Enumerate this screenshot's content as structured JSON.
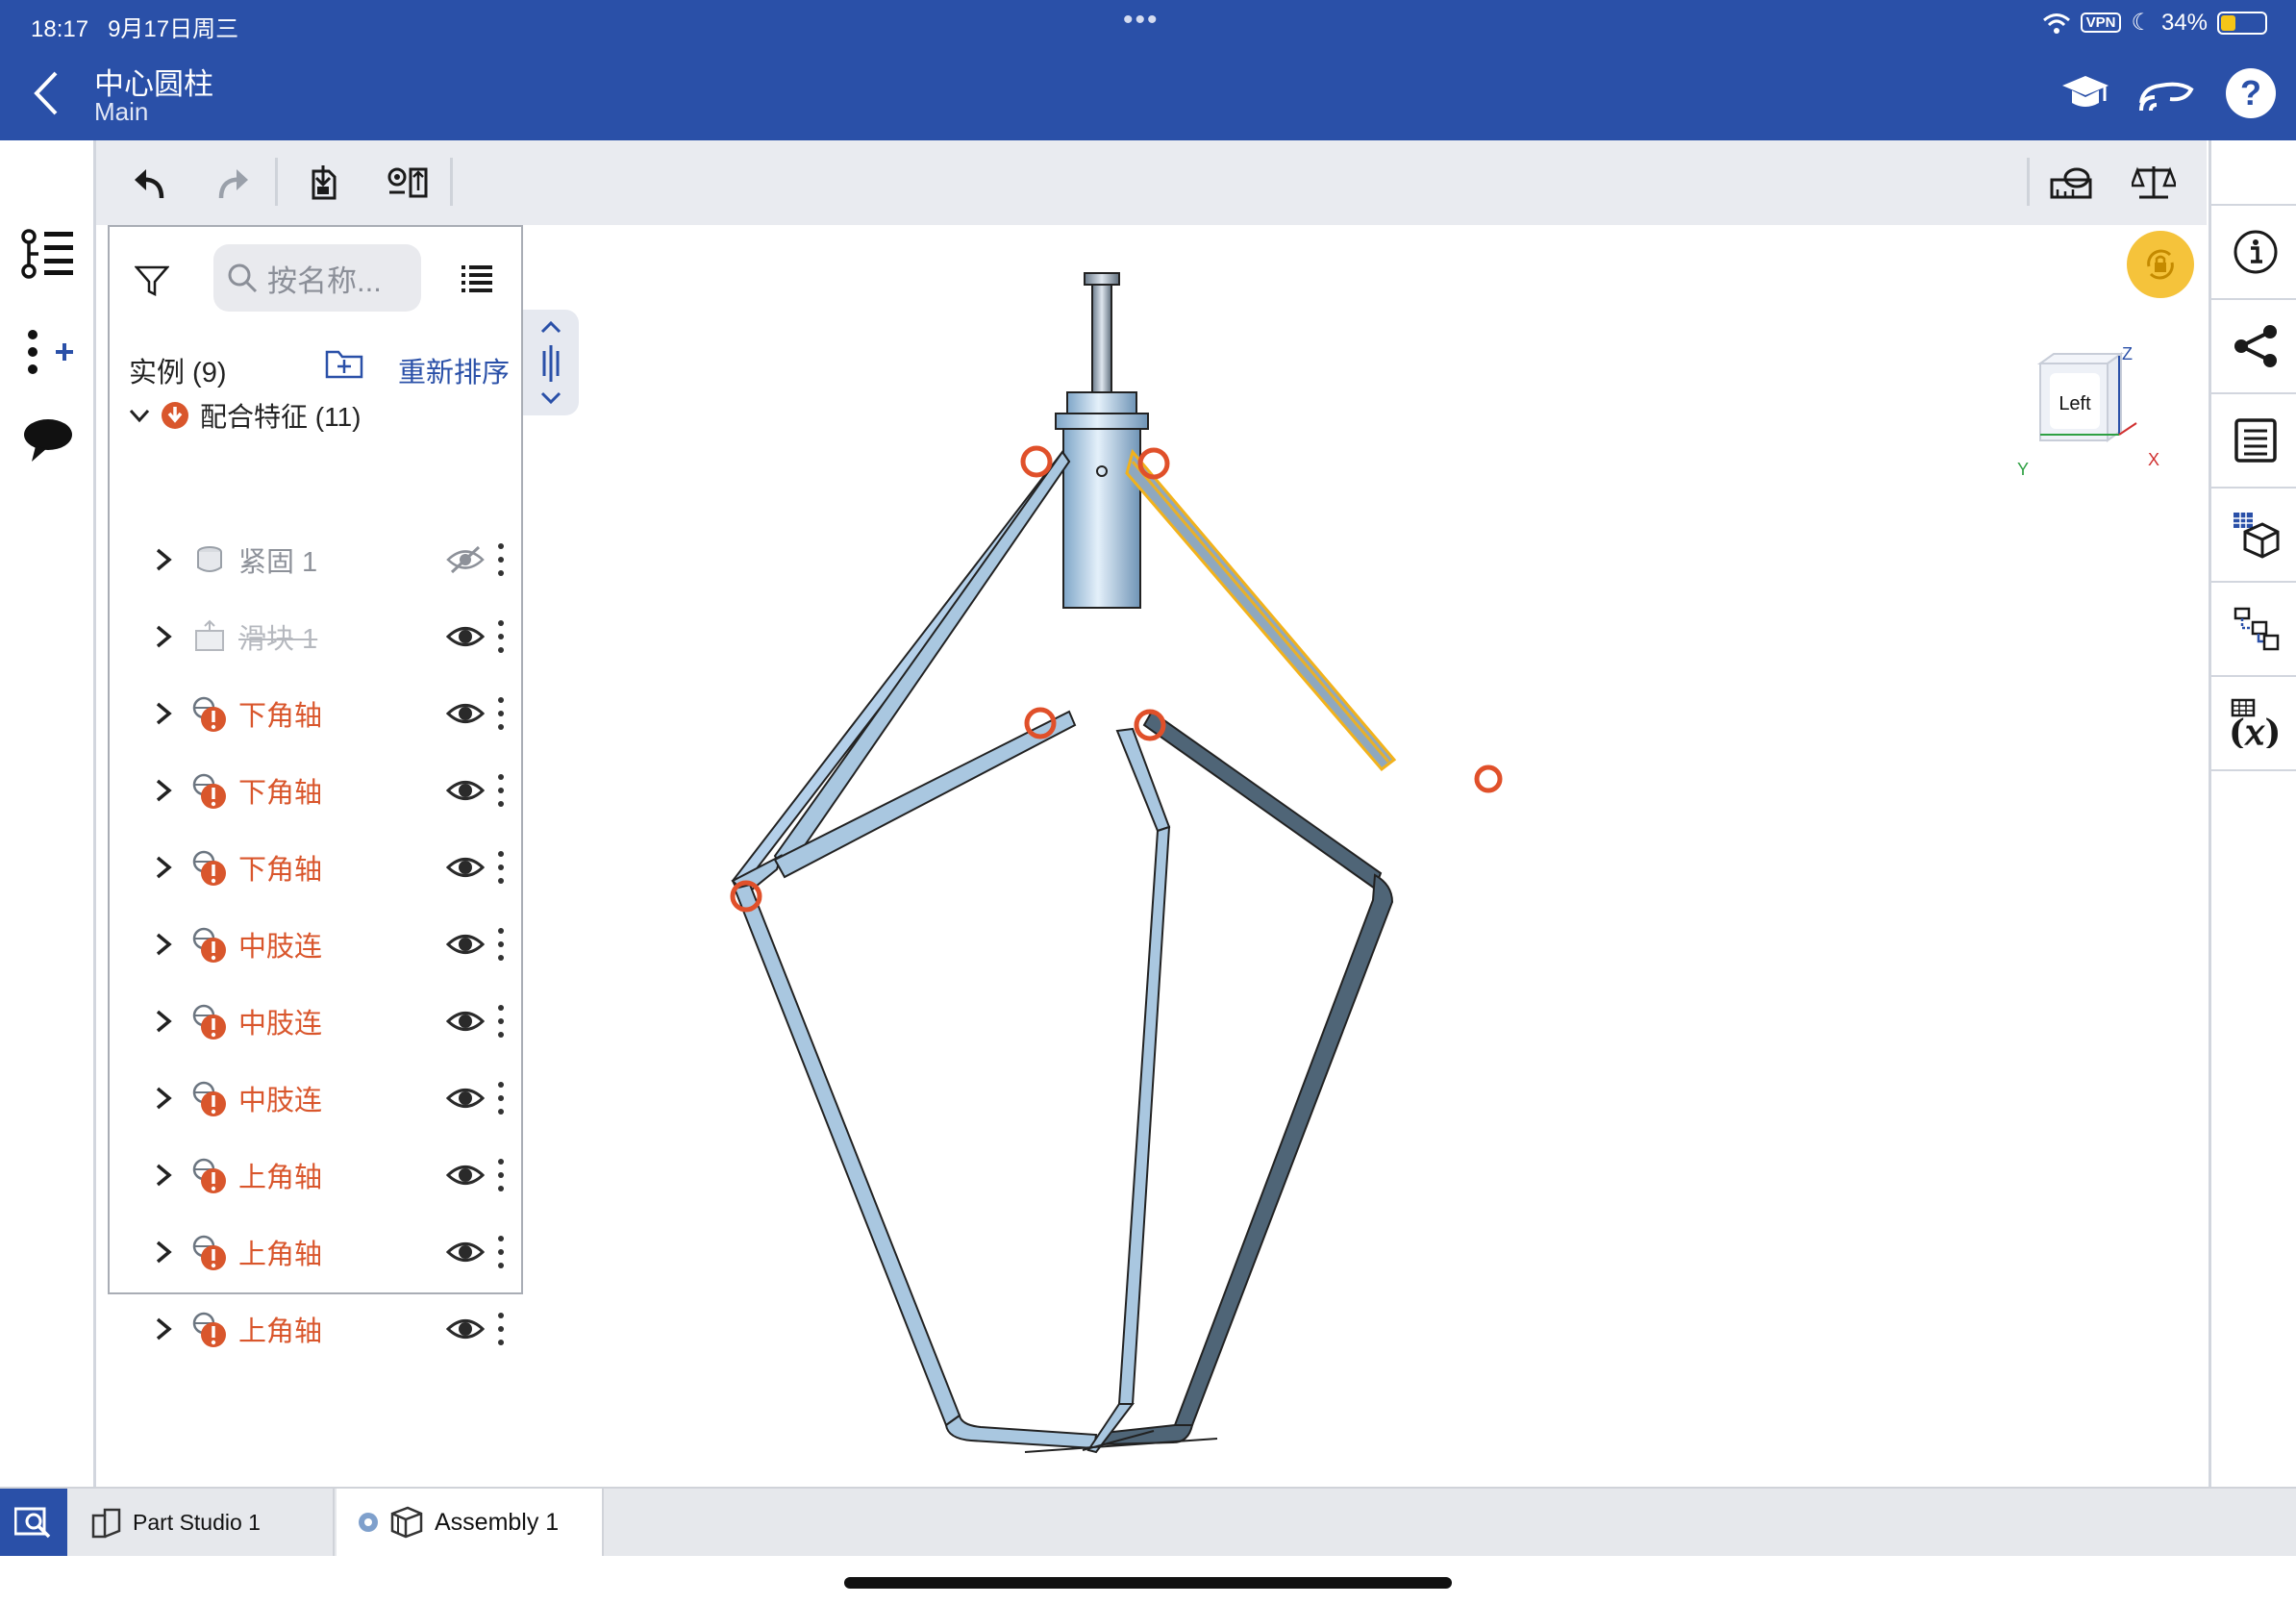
{
  "status": {
    "time": "18:17",
    "date": "9月17日周三",
    "vpn": "VPN",
    "battery": "34%",
    "battery_level": 0.34
  },
  "header": {
    "title": "中心圆柱",
    "subtitle": "Main",
    "icons": [
      "learning-center-icon",
      "connect-icon",
      "help-icon"
    ]
  },
  "left_rail": {
    "icons": [
      "feature-tree-icon",
      "insert-mate-icon",
      "comments-icon"
    ]
  },
  "toolbar": {
    "icons": [
      "undo-icon",
      "redo-icon",
      "insert-part-icon",
      "replicate-icon",
      "measure-icon",
      "mass-properties-icon"
    ]
  },
  "right_rail": {
    "icons": [
      "info-icon",
      "share-icon",
      "bom-icon",
      "appearance-icon",
      "configurations-icon",
      "variables-icon"
    ]
  },
  "panel": {
    "search_placeholder": "按名称...",
    "instances_label": "实例 (9)",
    "reorder_label": "重新排序",
    "mate_group_label": "配合特征 (11)",
    "rows": [
      {
        "label": "紧固 1",
        "state": "hidden"
      },
      {
        "label": "滑块 1",
        "state": "suppressed"
      },
      {
        "label": "下角轴",
        "state": "error"
      },
      {
        "label": "下角轴",
        "state": "error"
      },
      {
        "label": "下角轴",
        "state": "error"
      },
      {
        "label": "中肢连",
        "state": "error"
      },
      {
        "label": "中肢连",
        "state": "error"
      },
      {
        "label": "中肢连",
        "state": "error"
      },
      {
        "label": "上角轴",
        "state": "error"
      },
      {
        "label": "上角轴",
        "state": "error"
      },
      {
        "label": "上角轴",
        "state": "error"
      }
    ]
  },
  "viewcube": {
    "face": "Left",
    "axis_z": "Z",
    "axis_y": "Y",
    "axis_x": "X"
  },
  "tabs": {
    "part_studio": "Part Studio 1",
    "assembly": "Assembly 1"
  },
  "colors": {
    "brand": "#2a50a8",
    "error": "#d9562c",
    "part_fill": "#a9c7e0",
    "highlight": "#f2b21b"
  }
}
